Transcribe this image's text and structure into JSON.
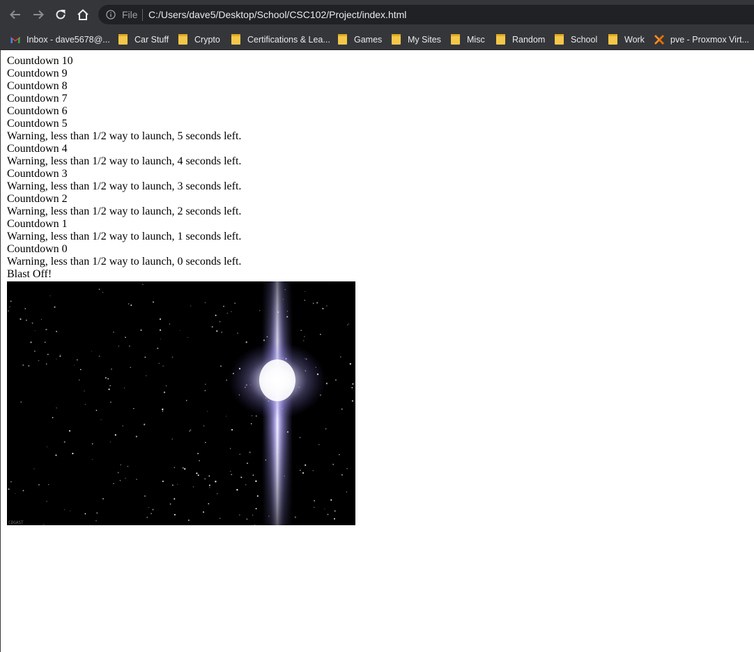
{
  "browser": {
    "scheme_label": "File",
    "url": "C:/Users/dave5/Desktop/School/CSC102/Project/index.html",
    "bookmarks": [
      {
        "label": "Inbox - dave5678@...",
        "icon": "gmail-icon"
      },
      {
        "label": "Car Stuff",
        "icon": "folder-icon"
      },
      {
        "label": "Crypto",
        "icon": "folder-icon"
      },
      {
        "label": "Certifications & Lea...",
        "icon": "folder-icon"
      },
      {
        "label": "Games",
        "icon": "folder-icon"
      },
      {
        "label": "My Sites",
        "icon": "folder-icon"
      },
      {
        "label": "Misc",
        "icon": "folder-icon"
      },
      {
        "label": "Random",
        "icon": "folder-icon"
      },
      {
        "label": "School",
        "icon": "folder-icon"
      },
      {
        "label": "Work",
        "icon": "folder-icon"
      },
      {
        "label": "pve - Proxmox Virt...",
        "icon": "proxmox-icon"
      }
    ]
  },
  "page": {
    "lines": [
      "Countdown 10",
      "Countdown 9",
      "Countdown 8",
      "Countdown 7",
      "Countdown 6",
      "Countdown 5",
      "Warning, less than 1/2 way to launch, 5 seconds left.",
      "Countdown 4",
      "Warning, less than 1/2 way to launch, 4 seconds left.",
      "Countdown 3",
      "Warning, less than 1/2 way to launch, 3 seconds left.",
      "Countdown 2",
      "Warning, less than 1/2 way to launch, 2 seconds left.",
      "Countdown 1",
      "Warning, less than 1/2 way to launch, 1 seconds left.",
      "Countdown 0",
      "Warning, less than 1/2 way to launch, 0 seconds left.",
      "Blast Off!"
    ],
    "image_watermark": "CDGAST"
  }
}
